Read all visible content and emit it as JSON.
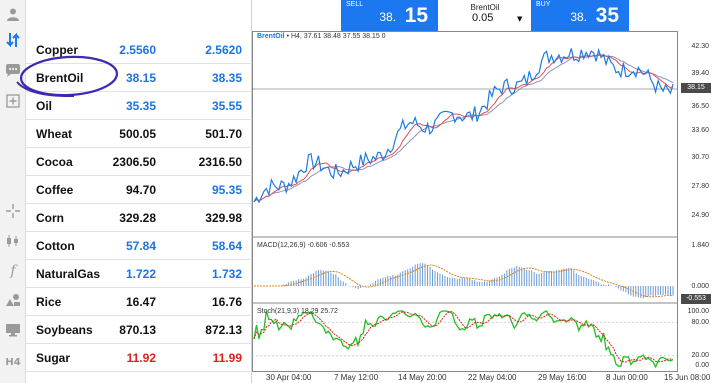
{
  "toolbar": {
    "items": [
      "user-icon",
      "sort-icon",
      "chat-icon",
      "add-chart-icon",
      "crosshair-icon",
      "candles-icon",
      "function-icon",
      "objects-icon",
      "templates-icon",
      "timeframe-icon"
    ],
    "timeframe_label": "H4"
  },
  "quotes": [
    {
      "name": "Copper",
      "bid": "2.5560",
      "ask": "2.5620",
      "bid_color": "blue",
      "ask_color": "blue"
    },
    {
      "name": "BrentOil",
      "bid": "38.15",
      "ask": "38.35",
      "bid_color": "blue",
      "ask_color": "blue"
    },
    {
      "name": "Oil",
      "bid": "35.35",
      "ask": "35.55",
      "bid_color": "blue",
      "ask_color": "blue"
    },
    {
      "name": "Wheat",
      "bid": "500.05",
      "ask": "501.70",
      "bid_color": "black",
      "ask_color": "black"
    },
    {
      "name": "Cocoa",
      "bid": "2306.50",
      "ask": "2316.50",
      "bid_color": "black",
      "ask_color": "black"
    },
    {
      "name": "Coffee",
      "bid": "94.70",
      "ask": "95.35",
      "bid_color": "black",
      "ask_color": "blue"
    },
    {
      "name": "Corn",
      "bid": "329.28",
      "ask": "329.98",
      "bid_color": "black",
      "ask_color": "black"
    },
    {
      "name": "Cotton",
      "bid": "57.84",
      "ask": "58.64",
      "bid_color": "blue",
      "ask_color": "blue"
    },
    {
      "name": "NaturalGas",
      "bid": "1.722",
      "ask": "1.732",
      "bid_color": "blue",
      "ask_color": "blue"
    },
    {
      "name": "Rice",
      "bid": "16.47",
      "ask": "16.76",
      "bid_color": "black",
      "ask_color": "black"
    },
    {
      "name": "Soybeans",
      "bid": "870.13",
      "ask": "872.13",
      "bid_color": "black",
      "ask_color": "black"
    },
    {
      "name": "Sugar",
      "bid": "11.92",
      "ask": "11.99",
      "bid_color": "red",
      "ask_color": "red"
    }
  ],
  "trade": {
    "sell_label": "SELL",
    "sell_small": "38.",
    "sell_big": "15",
    "buy_label": "BUY",
    "buy_small": "38.",
    "buy_big": "35",
    "symbol": "BrentOil",
    "volume": "0.05",
    "dropdown_arrow": "▼"
  },
  "chart": {
    "price_header": {
      "symbol": "BrentOil",
      "rest": " • H4, 37.61 38.48 37.55 38.15 0"
    },
    "price_axis": [
      "42.30",
      "39.40",
      "36.50",
      "33.60",
      "30.70",
      "27.80",
      "24.90"
    ],
    "current_price": "38.15",
    "macd_header": "MACD(12,26,9) -0.606 -0.553",
    "macd_axis": [
      "1.840",
      "0.000",
      "-0.553"
    ],
    "stoch_header": "Stoch(21,9,3) 18.29 25.72",
    "stoch_axis": [
      "100.00",
      "80.00",
      "20.00",
      "0.00"
    ],
    "time_axis": [
      "30 Apr 04:00",
      "7 May 12:00",
      "14 May 20:00",
      "22 May 04:00",
      "29 May 16:00",
      "8 Jun 00:00",
      "15 Jun 08:00"
    ],
    "colors": {
      "price": "#1e7be0",
      "ma_fast": "#e05050",
      "ma_slow": "#9090c0",
      "histogram": "#6b9bd6",
      "signal": "#e08020",
      "stoch_main": "#20c020",
      "stoch_signal": "#e02020",
      "annotation": "#3a2bb0"
    }
  },
  "chart_data": {
    "type": "line",
    "title": "BrentOil • H4, 37.61 38.48 37.55 38.15 0",
    "x": [
      "30 Apr 04:00",
      "7 May 12:00",
      "14 May 20:00",
      "22 May 04:00",
      "29 May 16:00",
      "8 Jun 00:00",
      "15 Jun 08:00"
    ],
    "series": [
      {
        "name": "BrentOil",
        "values": [
          26.8,
          30.4,
          30.2,
          34.6,
          35.5,
          39.0,
          42.6,
          40.8,
          38.15
        ]
      }
    ],
    "ylim": [
      24.0,
      43.5
    ]
  }
}
